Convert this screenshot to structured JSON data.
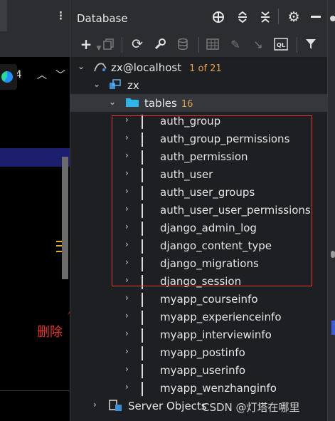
{
  "left_editor": {
    "status_count": "4",
    "annotation": "删除"
  },
  "panel": {
    "title": "Database"
  },
  "tree": {
    "connection": {
      "label": "zx@localhost",
      "meta": "1 of 21"
    },
    "schema": {
      "label": "zx"
    },
    "tables_folder": {
      "label": "tables",
      "count": "16"
    },
    "tables": [
      "auth_group",
      "auth_group_permissions",
      "auth_permission",
      "auth_user",
      "auth_user_groups",
      "auth_user_user_permissions",
      "django_admin_log",
      "django_content_type",
      "django_migrations",
      "django_session",
      "myapp_courseinfo",
      "myapp_experienceinfo",
      "myapp_interviewinfo",
      "myapp_postinfo",
      "myapp_userinfo",
      "myapp_wenzhanginfo"
    ],
    "server_objects": {
      "label": "Server Objects"
    }
  },
  "watermark": "CSDN @灯塔在哪里",
  "colors": {
    "annotation_red": "#e8312f",
    "count_orange": "#e0a34a",
    "selection": "#34383d"
  }
}
